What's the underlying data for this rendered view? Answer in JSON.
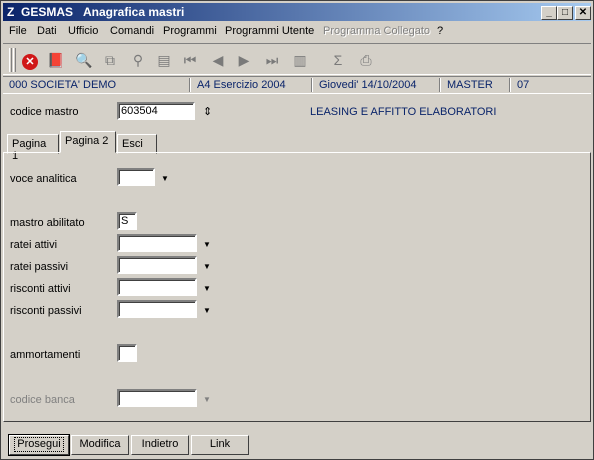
{
  "window": {
    "app_icon": "Z",
    "app_name": "GESMAS",
    "title": "Anagrafica mastri",
    "controls": {
      "minimize": "_",
      "maximize": "□",
      "close": "✕"
    }
  },
  "menu": [
    "File",
    "Dati",
    "Ufficio",
    "Comandi",
    "Programmi",
    "Programmi Utente",
    "Programma Collegato",
    "?"
  ],
  "toolbar": {
    "buttons": [
      {
        "name": "close-red-icon",
        "glyph": "✕"
      },
      {
        "name": "book-icon",
        "glyph": "📕"
      },
      {
        "name": "search-icon",
        "glyph": "🔍"
      },
      {
        "name": "copy-icon",
        "glyph": "⧉"
      },
      {
        "name": "binoculars-icon",
        "glyph": "⚲"
      },
      {
        "name": "list-icon",
        "glyph": "▤"
      },
      {
        "name": "first-icon",
        "glyph": "⏮"
      },
      {
        "name": "prev-icon",
        "glyph": "◀"
      },
      {
        "name": "next-icon",
        "glyph": "▶"
      },
      {
        "name": "last-icon",
        "glyph": "⏭"
      },
      {
        "name": "delete-icon",
        "glyph": "▥"
      },
      {
        "name": "sum-icon",
        "glyph": "Σ"
      },
      {
        "name": "print-icon",
        "glyph": "⎙"
      }
    ]
  },
  "info": {
    "company": "000 SOCIETA' DEMO",
    "exercise": "A4 Esercizio 2004",
    "date": "Giovedi'  14/10/2004",
    "user": "MASTER",
    "code": "07"
  },
  "header": {
    "codice_label": "codice mastro",
    "codice_value": "603504",
    "description": "LEASING E AFFITTO ELABORATORI",
    "arrow_glyph": "⇕"
  },
  "tabs": [
    "Pagina 1",
    "Pagina 2",
    "Esci"
  ],
  "form": {
    "voce_label": "voce analitica",
    "voce_value": "",
    "mastro_label": "mastro abilitato",
    "mastro_value": "S",
    "ratei_attivi_label": "ratei attivi",
    "ratei_passivi_label": "ratei passivi",
    "risconti_attivi_label": "risconti attivi",
    "risconti_passivi_label": "risconti passivi",
    "ammortamenti_label": "ammortamenti",
    "codice_banca_label": "codice banca",
    "dropdown_glyph": "▼"
  },
  "buttons": [
    "Prosegui",
    "Modifica",
    "Indietro",
    "Link"
  ]
}
